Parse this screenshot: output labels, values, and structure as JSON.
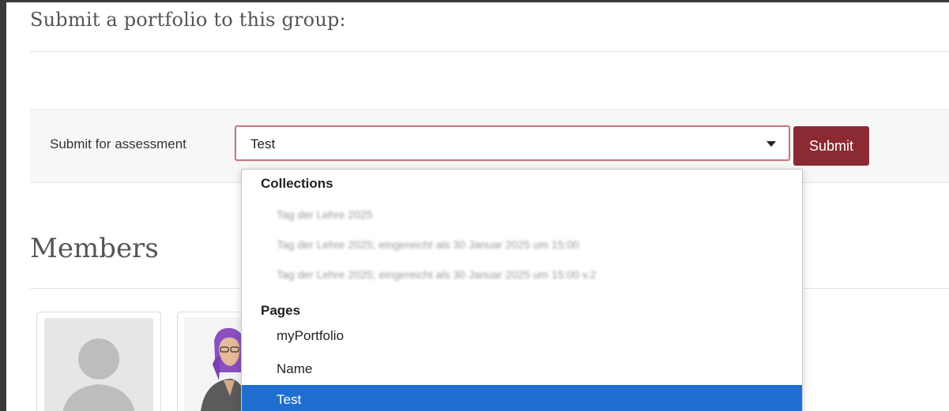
{
  "section": {
    "title": "Submit a portfolio to this group:"
  },
  "submit_form": {
    "label": "Submit for assessment",
    "selected_value": "Test",
    "submit_label": "Submit"
  },
  "members": {
    "title": "Members"
  },
  "dropdown": {
    "groups": [
      {
        "label": "Collections",
        "options": [
          "Tag der Lehre 2025",
          "Tag der Lehre 2025; eingereicht als 30 Januar 2025 um 15:00",
          "Tag der Lehre 2025; eingereicht als 30 Januar 2025 um 15:00 v.2"
        ]
      },
      {
        "label": "Pages",
        "options": [
          "myPortfolio",
          "Name",
          "Test"
        ]
      }
    ]
  },
  "colors": {
    "accent": "#8b2a33",
    "selection": "#1f6fd1",
    "select_border": "#c47b82"
  }
}
